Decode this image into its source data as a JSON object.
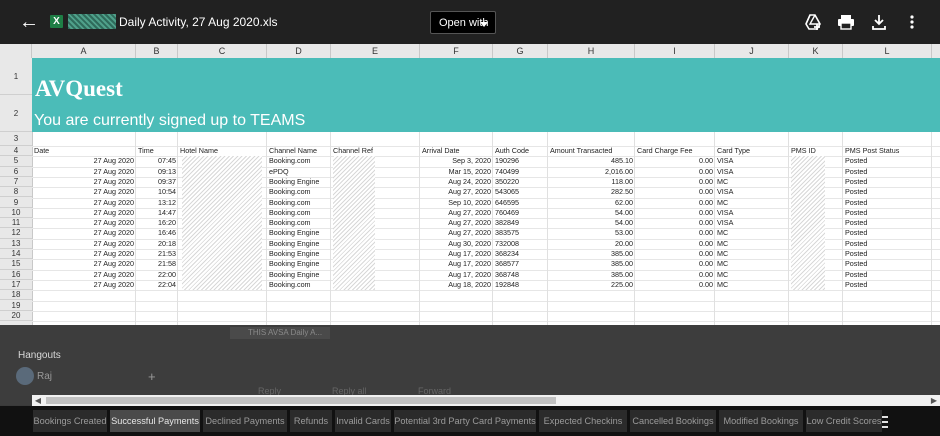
{
  "topbar": {
    "file_title": "Daily Activity, 27 Aug 2020.xls",
    "open_with": "Open with"
  },
  "columns": [
    "A",
    "B",
    "C",
    "D",
    "E",
    "F",
    "G",
    "H",
    "I",
    "J",
    "K",
    "L"
  ],
  "rows": [
    "1",
    "2",
    "3",
    "4",
    "5",
    "6",
    "7",
    "8",
    "9",
    "10",
    "11",
    "12",
    "13",
    "14",
    "15",
    "16",
    "17",
    "18",
    "19",
    "20"
  ],
  "banner": {
    "brand": "AVQuest",
    "subtitle": "You are currently signed up to TEAMS"
  },
  "table": {
    "headers": [
      "Date",
      "Time",
      "Hotel Name",
      "Channel Name",
      "Channel Ref",
      "Arrival Date",
      "Auth Code",
      "Amount Transacted",
      "Card Charge Fee",
      "Card Type",
      "PMS ID",
      "PMS Post Status"
    ],
    "rows": [
      [
        "27 Aug 2020",
        "07:45",
        "",
        "Booking.com",
        "",
        "Sep 3, 2020",
        "190296",
        "485.10",
        "0.00",
        "VISA",
        "",
        "Posted"
      ],
      [
        "27 Aug 2020",
        "09:13",
        "",
        "ePDQ",
        "",
        "Mar 15, 2020",
        "740499",
        "2,016.00",
        "0.00",
        "VISA",
        "",
        "Posted"
      ],
      [
        "27 Aug 2020",
        "09:37",
        "",
        "Booking Engine",
        "",
        "Aug 24, 2020",
        "350220",
        "118.00",
        "0.00",
        "MC",
        "",
        "Posted"
      ],
      [
        "27 Aug 2020",
        "10:54",
        "",
        "Booking.com",
        "",
        "Aug 27, 2020",
        "543065",
        "282.50",
        "0.00",
        "VISA",
        "",
        "Posted"
      ],
      [
        "27 Aug 2020",
        "13:12",
        "",
        "Booking.com",
        "",
        "Sep 10, 2020",
        "646595",
        "62.00",
        "0.00",
        "MC",
        "",
        "Posted"
      ],
      [
        "27 Aug 2020",
        "14:47",
        "",
        "Booking.com",
        "",
        "Aug 27, 2020",
        "760469",
        "54.00",
        "0.00",
        "VISA",
        "",
        "Posted"
      ],
      [
        "27 Aug 2020",
        "16:20",
        "",
        "Booking.com",
        "",
        "Aug 27, 2020",
        "382849",
        "54.00",
        "0.00",
        "VISA",
        "",
        "Posted"
      ],
      [
        "27 Aug 2020",
        "16:46",
        "",
        "Booking Engine",
        "",
        "Aug 27, 2020",
        "383575",
        "53.00",
        "0.00",
        "MC",
        "",
        "Posted"
      ],
      [
        "27 Aug 2020",
        "20:18",
        "",
        "Booking Engine",
        "",
        "Aug 30, 2020",
        "732008",
        "20.00",
        "0.00",
        "MC",
        "",
        "Posted"
      ],
      [
        "27 Aug 2020",
        "21:53",
        "",
        "Booking Engine",
        "",
        "Aug 17, 2020",
        "368234",
        "385.00",
        "0.00",
        "MC",
        "",
        "Posted"
      ],
      [
        "27 Aug 2020",
        "21:58",
        "",
        "Booking Engine",
        "",
        "Aug 17, 2020",
        "368577",
        "385.00",
        "0.00",
        "MC",
        "",
        "Posted"
      ],
      [
        "27 Aug 2020",
        "22:00",
        "",
        "Booking Engine",
        "",
        "Aug 17, 2020",
        "368748",
        "385.00",
        "0.00",
        "MC",
        "",
        "Posted"
      ],
      [
        "27 Aug 2020",
        "22:04",
        "",
        "Booking.com",
        "",
        "Aug 18, 2020",
        "192848",
        "225.00",
        "0.00",
        "MC",
        "",
        "Posted"
      ]
    ]
  },
  "below": {
    "hangouts": "Hangouts",
    "contact": "Raj",
    "plus": "+",
    "ghost_chip": "THIS AVSA Daily A...",
    "reply": "Reply",
    "reply_all": "Reply all",
    "forward": "Forward"
  },
  "tabs": [
    "Bookings Created",
    "Successful Payments",
    "Declined Payments",
    "Refunds",
    "Invalid Cards",
    "Potential 3rd Party Card Payments",
    "Expected Checkins",
    "Cancelled Bookings",
    "Modified Bookings",
    "Low Credit Scores"
  ],
  "active_tab": "Successful Payments",
  "colors": {
    "banner": "#4bbcb8",
    "topbar": "#212121",
    "xls_green": "#1e7e45"
  }
}
